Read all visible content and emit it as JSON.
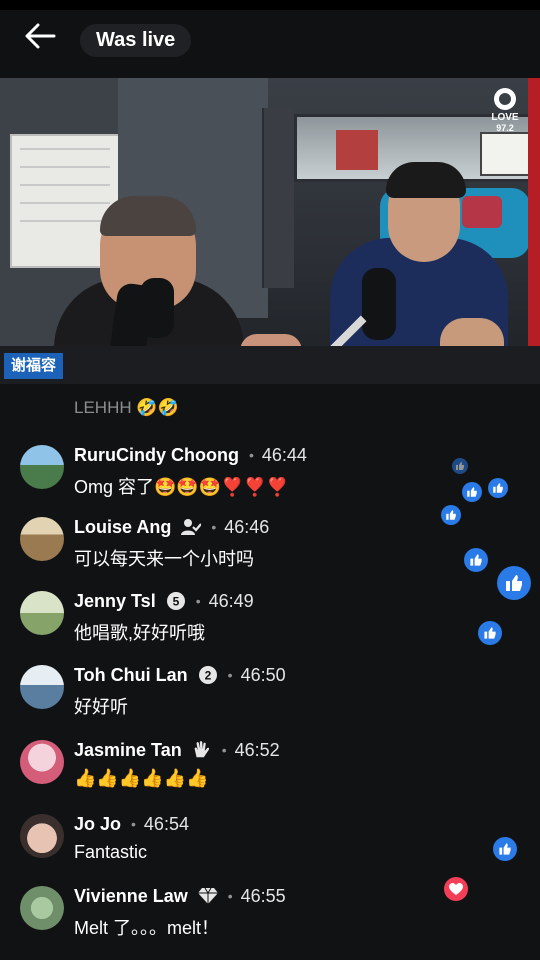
{
  "header": {
    "title": "Was live"
  },
  "video": {
    "logo_text": "LOVE",
    "logo_sub": "97.2",
    "name_tag": "谢福容"
  },
  "comments": {
    "partial_text": "LEHHH 🤣🤣",
    "items": [
      {
        "name": "RuruCindy Choong",
        "time": "46:44",
        "text": "Omg 容了🤩🤩🤩❣️❣️❣️",
        "badge": "",
        "avatar_color": "#4a7b4a"
      },
      {
        "name": "Louise Ang",
        "time": "46:46",
        "text": "可以每天来一个小时吗",
        "badge": "person-check-icon",
        "avatar_color": "#c9a46c"
      },
      {
        "name": "Jenny Tsl",
        "time": "46:49",
        "text": "他唱歌,好好听哦",
        "badge": "5",
        "avatar_color": "#86a36a"
      },
      {
        "name": "Toh Chui Lan",
        "time": "46:50",
        "text": "好好听",
        "badge": "2",
        "avatar_color": "#5a7ea0"
      },
      {
        "name": "Jasmine Tan",
        "time": "46:52",
        "text": "👍👍👍👍👍👍",
        "badge": "wave-icon",
        "avatar_color": "#d45d7a"
      },
      {
        "name": "Jo Jo",
        "time": "46:54",
        "text": "Fantastic",
        "badge": "",
        "avatar_color": "#e6c3b3"
      },
      {
        "name": "Vivienne Law",
        "time": "46:55",
        "text": "Melt 了。。。melt！",
        "badge": "diamond-icon",
        "avatar_color": "#6f8f6a"
      }
    ]
  },
  "colors": {
    "like_blue": "#2a7ae8",
    "heart_red": "#f33e58",
    "name_tag_blue": "#1c62b8"
  }
}
